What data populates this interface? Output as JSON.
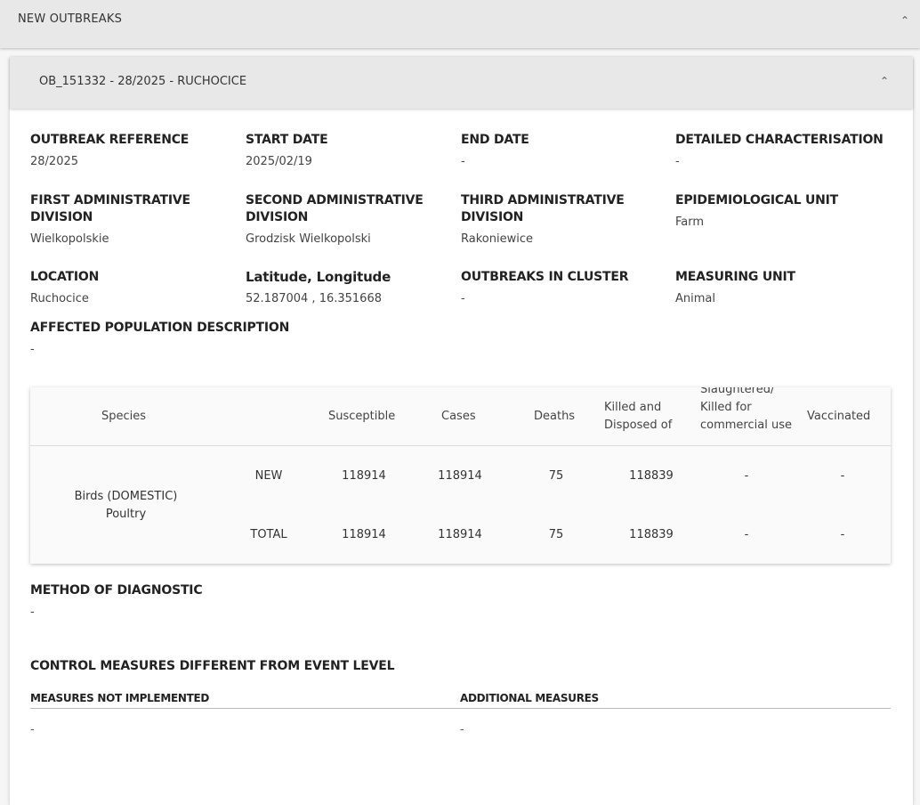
{
  "outer_section": {
    "title": "NEW OUTBREAKS"
  },
  "outbreak_panel": {
    "title": "OB_151332 - 28/2025 - RUCHOCICE",
    "fields": {
      "outbreak_reference": {
        "label": "OUTBREAK REFERENCE",
        "value": "28/2025"
      },
      "start_date": {
        "label": "START DATE",
        "value": "2025/02/19"
      },
      "end_date": {
        "label": "END DATE",
        "value": "-"
      },
      "detailed_characterisation": {
        "label": "DETAILED CHARACTERISATION",
        "value": "-"
      },
      "first_admin": {
        "label": "FIRST ADMINISTRATIVE DIVISION",
        "value": "Wielkopolskie"
      },
      "second_admin": {
        "label": "SECOND ADMINISTRATIVE DIVISION",
        "value": "Grodzisk Wielkopolski"
      },
      "third_admin": {
        "label": "THIRD ADMINISTRATIVE DIVISION",
        "value": "Rakoniewice"
      },
      "epi_unit": {
        "label": "EPIDEMIOLOGICAL UNIT",
        "value": "Farm"
      },
      "location": {
        "label": "LOCATION",
        "value": "Ruchocice"
      },
      "lat_long": {
        "label": "Latitude, Longitude",
        "value": "52.187004 , 16.351668"
      },
      "outbreaks_in_cluster": {
        "label": "OUTBREAKS IN CLUSTER",
        "value": "-"
      },
      "measuring_unit": {
        "label": "MEASURING UNIT",
        "value": "Animal"
      },
      "affected_population": {
        "label": "AFFECTED POPULATION DESCRIPTION",
        "value": "-"
      }
    },
    "table": {
      "headers": {
        "species": "Species",
        "susceptible": "Susceptible",
        "cases": "Cases",
        "deaths": "Deaths",
        "killed_disposed": "Killed and Disposed of",
        "slaughtered": "Slaughtered/ Killed for commercial use",
        "vaccinated": "Vaccinated"
      },
      "species_name": "Birds (DOMESTIC) Poultry",
      "rows": [
        {
          "type": "NEW",
          "susceptible": "118914",
          "cases": "118914",
          "deaths": "75",
          "killed_disposed": "118839",
          "slaughtered": "-",
          "vaccinated": "-"
        },
        {
          "type": "TOTAL",
          "susceptible": "118914",
          "cases": "118914",
          "deaths": "75",
          "killed_disposed": "118839",
          "slaughtered": "-",
          "vaccinated": "-"
        }
      ]
    },
    "method_of_diagnostic": {
      "label": "METHOD OF DIAGNOSTIC",
      "value": "-"
    },
    "control_measures": {
      "title": "CONTROL MEASURES DIFFERENT FROM EVENT LEVEL",
      "not_implemented": {
        "label": "MEASURES NOT IMPLEMENTED",
        "value": "-"
      },
      "additional": {
        "label": "ADDITIONAL MEASURES",
        "value": "-"
      }
    }
  }
}
